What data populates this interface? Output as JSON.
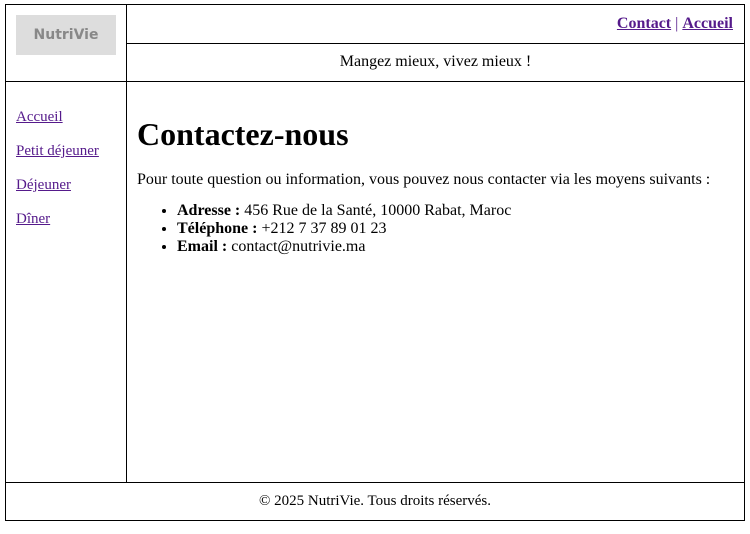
{
  "logo": {
    "text": "NutriVie"
  },
  "topnav": {
    "links": [
      {
        "label": "Contact"
      },
      {
        "label": "Accueil"
      }
    ],
    "separator": "|"
  },
  "tagline": "Mangez mieux, vivez mieux !",
  "sidebar": {
    "items": [
      {
        "label": "Accueil"
      },
      {
        "label": "Petit déjeuner"
      },
      {
        "label": "Déjeuner"
      },
      {
        "label": "Dîner"
      }
    ]
  },
  "main": {
    "title": "Contactez-nous",
    "intro": "Pour toute question ou information, vous pouvez nous contacter via les moyens suivants :",
    "contacts": [
      {
        "label": "Adresse :",
        "value": "456 Rue de la Santé, 10000 Rabat, Maroc"
      },
      {
        "label": "Téléphone :",
        "value": "+212 7 37 89 01 23"
      },
      {
        "label": "Email :",
        "value": "contact@nutrivie.ma"
      }
    ]
  },
  "footer": {
    "text": "© 2025 NutriVie. Tous droits réservés."
  },
  "colors": {
    "link_visited": "#551a8b",
    "logo_bg": "#dddddd",
    "logo_text": "#888888",
    "border": "#000000"
  }
}
